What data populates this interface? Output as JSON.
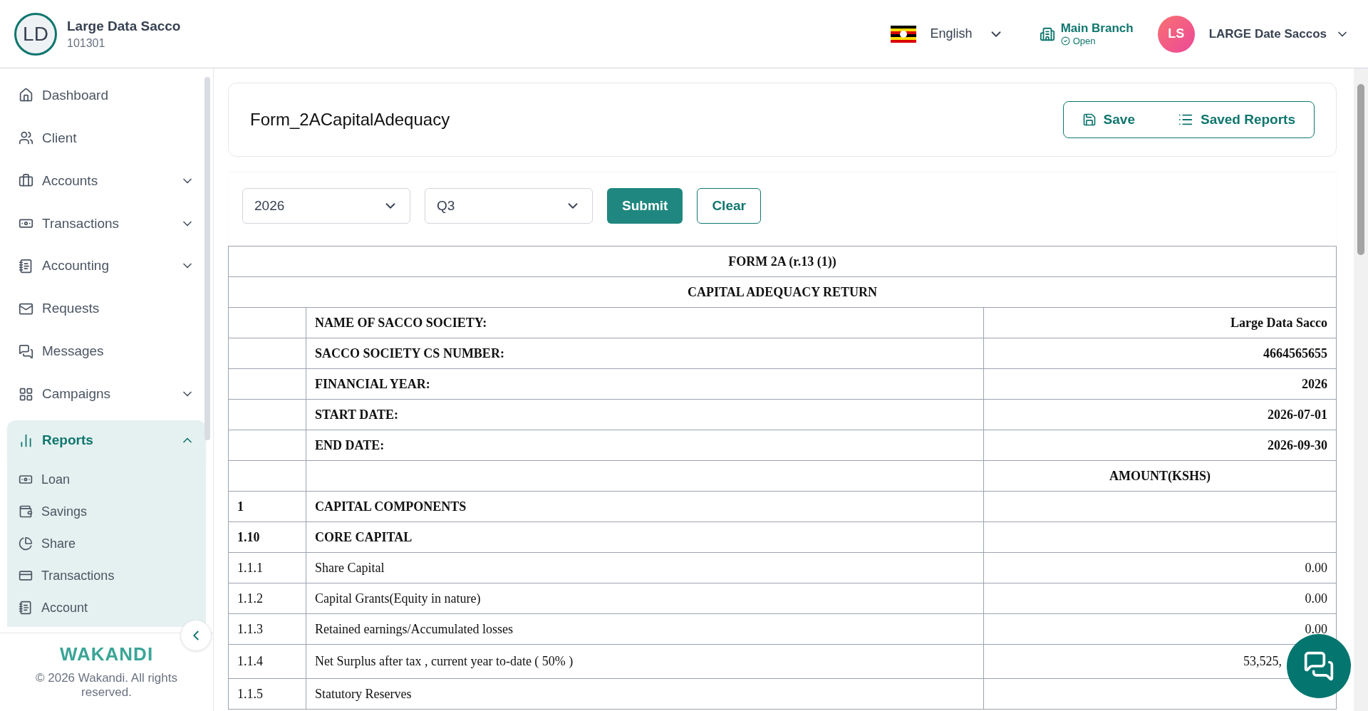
{
  "header": {
    "org_initials": "LD",
    "org_name": "Large Data Sacco",
    "org_code": "101301",
    "language": "English",
    "branch": "Main Branch",
    "branch_status": "Open",
    "user_initials": "LS",
    "user_name": "LARGE Date Saccos"
  },
  "sidebar": {
    "items": [
      {
        "label": "Dashboard",
        "expandable": false,
        "expanded": false,
        "selected": false
      },
      {
        "label": "Client",
        "expandable": false,
        "expanded": false,
        "selected": false
      },
      {
        "label": "Accounts",
        "expandable": true,
        "expanded": false,
        "selected": false
      },
      {
        "label": "Transactions",
        "expandable": true,
        "expanded": false,
        "selected": false
      },
      {
        "label": "Accounting",
        "expandable": true,
        "expanded": false,
        "selected": false
      },
      {
        "label": "Requests",
        "expandable": false,
        "expanded": false,
        "selected": false
      },
      {
        "label": "Messages",
        "expandable": false,
        "expanded": false,
        "selected": false
      },
      {
        "label": "Campaigns",
        "expandable": true,
        "expanded": false,
        "selected": false
      },
      {
        "label": "Reports",
        "expandable": true,
        "expanded": true,
        "selected": true,
        "children": [
          {
            "label": "Loan"
          },
          {
            "label": "Savings"
          },
          {
            "label": "Share"
          },
          {
            "label": "Transactions"
          },
          {
            "label": "Account"
          }
        ]
      }
    ],
    "brand": "WAKANDI",
    "copyright": "© 2026 Wakandi. All rights reserved."
  },
  "page": {
    "title": "Form_2ACapitalAdequacy",
    "save": "Save",
    "saved_reports": "Saved Reports",
    "year": "2026",
    "quarter": "Q3",
    "submit": "Submit",
    "clear": "Clear"
  },
  "table": {
    "title_rows": [
      "FORM 2A (r.13 (1))",
      "CAPITAL ADEQUACY RETURN"
    ],
    "rows": [
      {
        "kind": "info",
        "label": "NAME OF SACCO SOCIETY:",
        "value": "Large Data Sacco"
      },
      {
        "kind": "info",
        "label": "SACCO SOCIETY CS NUMBER:",
        "value": "4664565655"
      },
      {
        "kind": "info",
        "label": "FINANCIAL YEAR:",
        "value": "2026"
      },
      {
        "kind": "info",
        "label": "START DATE:",
        "value": "2026-07-01"
      },
      {
        "kind": "info",
        "label": "END DATE:",
        "value": "2026-09-30"
      },
      {
        "kind": "heading",
        "value": "AMOUNT(KSHS)"
      },
      {
        "kind": "section",
        "code": "1",
        "label": "CAPITAL COMPONENTS"
      },
      {
        "kind": "section",
        "code": "1.10",
        "label": "CORE CAPITAL"
      },
      {
        "kind": "line",
        "code": "1.1.1",
        "label": "Share Capital",
        "value": "0.00"
      },
      {
        "kind": "line",
        "code": "1.1.2",
        "label": "Capital Grants(Equity in nature)",
        "value": "0.00"
      },
      {
        "kind": "line",
        "code": "1.1.3",
        "label": "Retained earnings/Accumulated losses",
        "value": "0.00"
      },
      {
        "kind": "covered_line",
        "code": "1.1.4",
        "label": "Net Surplus after tax , current year to-date ( 50% )",
        "value": "53,525,"
      },
      {
        "kind": "line",
        "code": "1.1.5",
        "label": "Statutory Reserves"
      }
    ]
  }
}
